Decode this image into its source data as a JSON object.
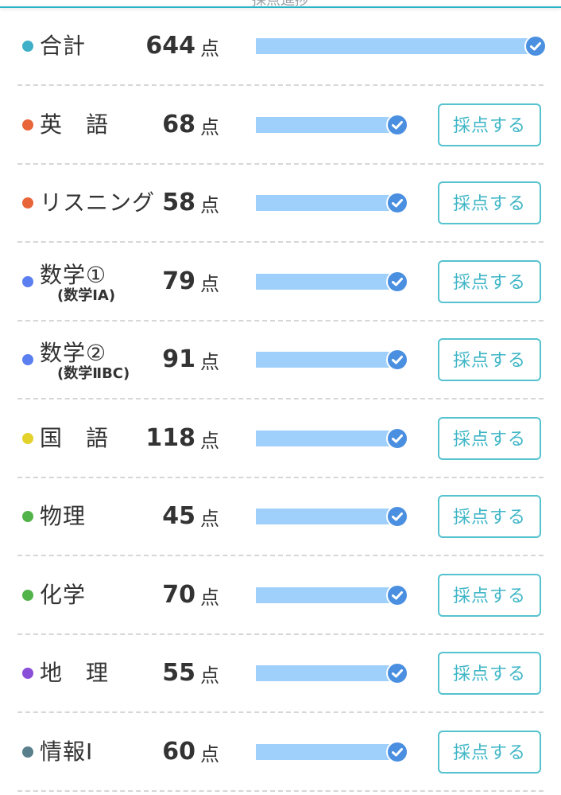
{
  "header": {
    "caption": "採点進捗"
  },
  "rows": [
    {
      "name": "●合計",
      "label": "合計",
      "score": "644",
      "unit": "点",
      "dot_color": "#3fb0c8",
      "progress": 1.0,
      "button": null
    },
    {
      "label": "英　語",
      "score": "68",
      "unit": "点",
      "dot_color": "#e8653a",
      "progress": 1.0,
      "button": "採点する"
    },
    {
      "label": "リスニング",
      "score": "58",
      "unit": "点",
      "dot_color": "#e8653a",
      "progress": 1.0,
      "button": "採点する"
    },
    {
      "label": "数学①",
      "sublabel": "(数学ⅠA)",
      "score": "79",
      "unit": "点",
      "dot_color": "#5b7ff0",
      "progress": 1.0,
      "button": "採点する"
    },
    {
      "label": "数学②",
      "sublabel": "(数学ⅡBC)",
      "score": "91",
      "unit": "点",
      "dot_color": "#5b7ff0",
      "progress": 1.0,
      "button": "採点する"
    },
    {
      "label": "国　語",
      "score": "118",
      "unit": "点",
      "dot_color": "#e3d22c",
      "progress": 1.0,
      "button": "採点する"
    },
    {
      "label": "物理",
      "score": "45",
      "unit": "点",
      "dot_color": "#52b34a",
      "progress": 1.0,
      "button": "採点する"
    },
    {
      "label": "化学",
      "score": "70",
      "unit": "点",
      "dot_color": "#52b34a",
      "progress": 1.0,
      "button": "採点する"
    },
    {
      "label": "地　理",
      "score": "55",
      "unit": "点",
      "dot_color": "#8a4fd8",
      "progress": 1.0,
      "button": "採点する"
    },
    {
      "label": "情報Ⅰ",
      "score": "60",
      "unit": "点",
      "dot_color": "#5a7f8c",
      "progress": 1.0,
      "button": "採点する"
    }
  ],
  "colors": {
    "accent": "#3fb6c6",
    "bar": "#9fd0fb",
    "check": "#4a8fe0"
  },
  "icons": {
    "check": "check-circle-icon"
  }
}
